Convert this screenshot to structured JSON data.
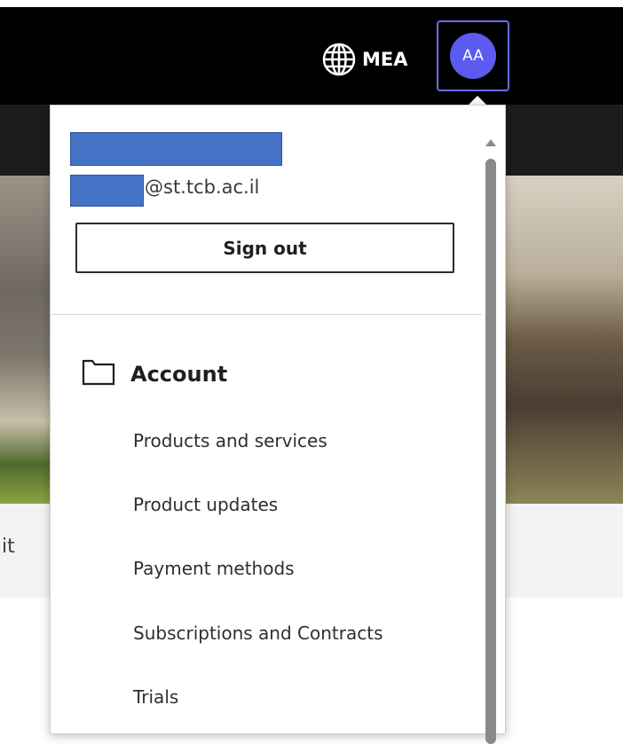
{
  "header": {
    "region_label": "MEA",
    "avatar_initials": "AA"
  },
  "background": {
    "band_text": "it"
  },
  "account_menu": {
    "email_domain": "@st.tcb.ac.il",
    "sign_out_label": "Sign out",
    "section_title": "Account",
    "items": [
      {
        "label": "Products and services"
      },
      {
        "label": "Product updates"
      },
      {
        "label": "Payment methods"
      },
      {
        "label": "Subscriptions and Contracts"
      },
      {
        "label": "Trials"
      }
    ]
  },
  "icons": {
    "region": "globe-icon",
    "section": "folder-icon"
  },
  "colors": {
    "header_bg": "#000000",
    "avatar_bg": "#5b5bef",
    "avatar_border": "#6c6cf0",
    "redaction": "#4472c4"
  }
}
